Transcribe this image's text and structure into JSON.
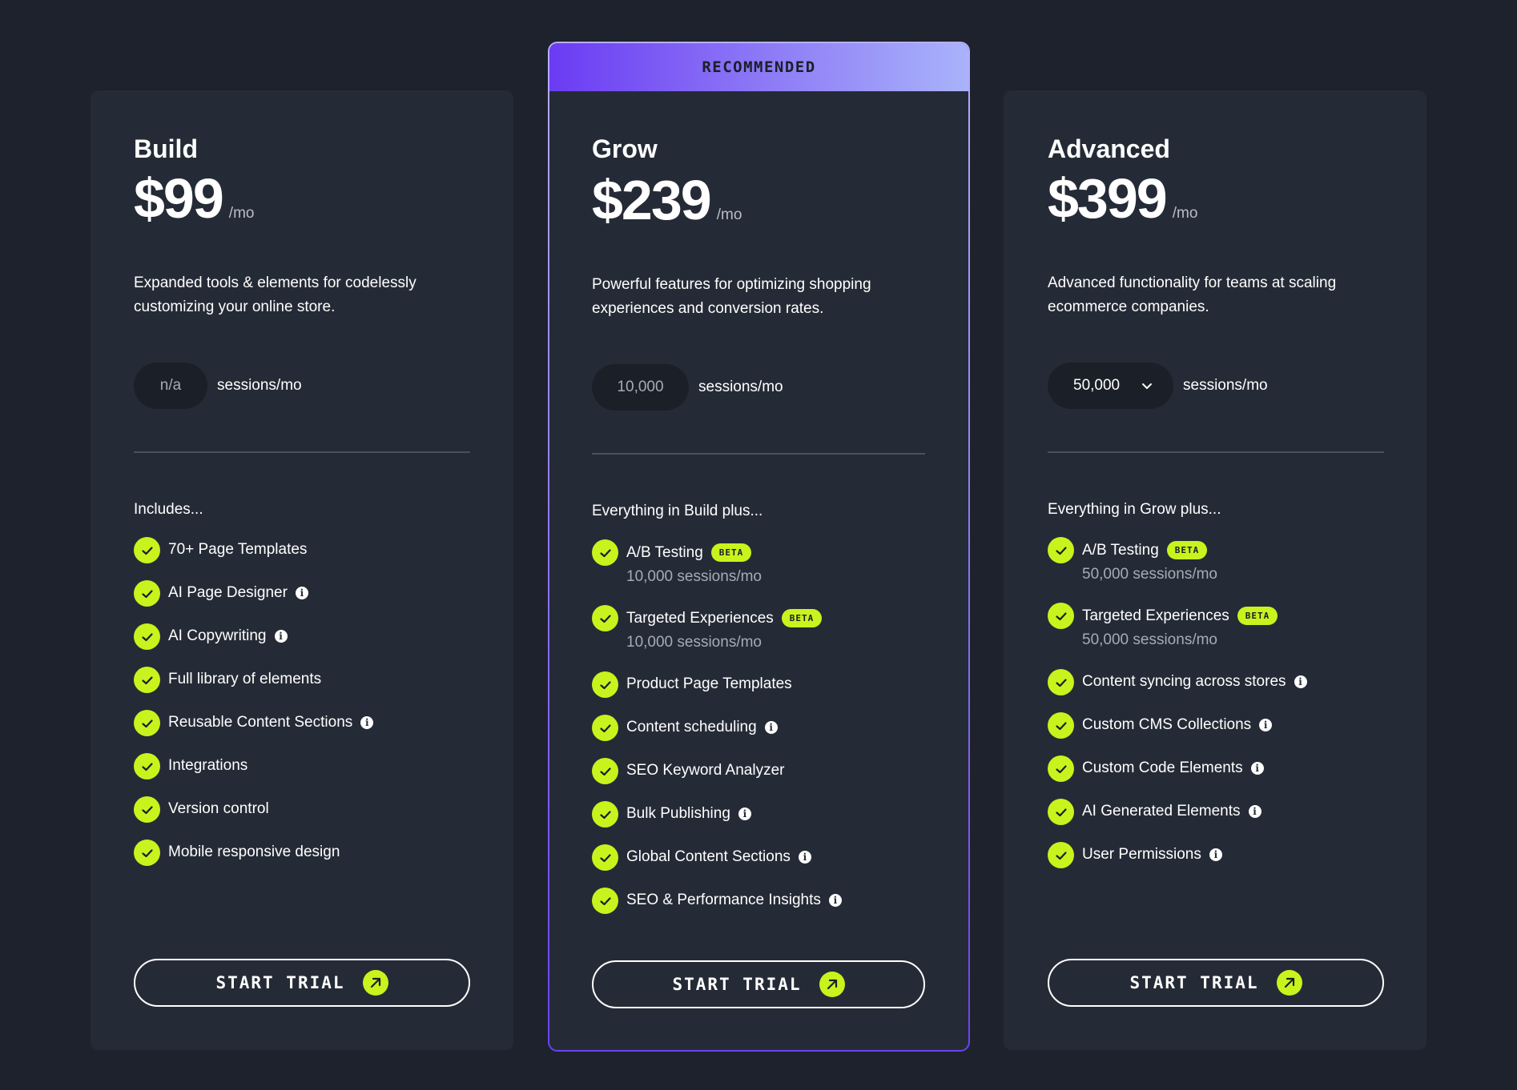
{
  "colors": {
    "background": "#1d222c",
    "card": "#252b36",
    "accent": "#c8f31d",
    "ribbon_start": "#6b3bf3",
    "ribbon_end": "#a9b3fa"
  },
  "icons": {
    "check": "check-icon",
    "info": "info-icon",
    "arrow": "arrow-up-right-icon",
    "chevron": "chevron-down-icon"
  },
  "plans": [
    {
      "name": "Build",
      "price": "$99",
      "per": "/mo",
      "description": "Expanded tools & elements for codelessly customizing your online store.",
      "sessions_value": "n/a",
      "sessions_label": "sessions/mo",
      "includes_title": "Includes...",
      "features": [
        {
          "label": "70+ Page Templates"
        },
        {
          "label": "AI Page Designer",
          "info": true
        },
        {
          "label": "AI Copywriting",
          "info": true
        },
        {
          "label": "Full library of elements"
        },
        {
          "label": "Reusable Content Sections",
          "info": true
        },
        {
          "label": "Integrations"
        },
        {
          "label": "Version control"
        },
        {
          "label": "Mobile responsive design"
        }
      ],
      "cta_label": "START TRIAL"
    },
    {
      "ribbon": "RECOMMENDED",
      "name": "Grow",
      "price": "$239",
      "per": "/mo",
      "description": "Powerful features for optimizing shopping experiences and conversion rates.",
      "sessions_value": "10,000",
      "sessions_label": "sessions/mo",
      "includes_title": "Everything in Build plus...",
      "features": [
        {
          "label": "A/B Testing",
          "badge": "BETA",
          "sub": "10,000 sessions/mo"
        },
        {
          "label": "Targeted Experiences",
          "badge": "BETA",
          "sub": "10,000 sessions/mo"
        },
        {
          "label": "Product Page Templates"
        },
        {
          "label": "Content scheduling",
          "info": true
        },
        {
          "label": "SEO Keyword Analyzer"
        },
        {
          "label": "Bulk Publishing",
          "info": true
        },
        {
          "label": "Global Content Sections",
          "info": true
        },
        {
          "label": "SEO & Performance Insights",
          "info": true
        }
      ],
      "cta_label": "START TRIAL"
    },
    {
      "name": "Advanced",
      "price": "$399",
      "per": "/mo",
      "description": "Advanced functionality for teams at scaling ecommerce companies.",
      "sessions_value": "50,000",
      "sessions_label": "sessions/mo",
      "includes_title": "Everything in Grow plus...",
      "features": [
        {
          "label": "A/B Testing",
          "badge": "BETA",
          "sub": "50,000 sessions/mo"
        },
        {
          "label": "Targeted Experiences",
          "badge": "BETA",
          "sub": "50,000 sessions/mo"
        },
        {
          "label": "Content syncing across stores",
          "info": true
        },
        {
          "label": "Custom CMS Collections",
          "info": true
        },
        {
          "label": "Custom Code Elements",
          "info": true
        },
        {
          "label": "AI Generated Elements",
          "info": true
        },
        {
          "label": "User Permissions",
          "info": true
        }
      ],
      "cta_label": "START TRIAL"
    }
  ]
}
